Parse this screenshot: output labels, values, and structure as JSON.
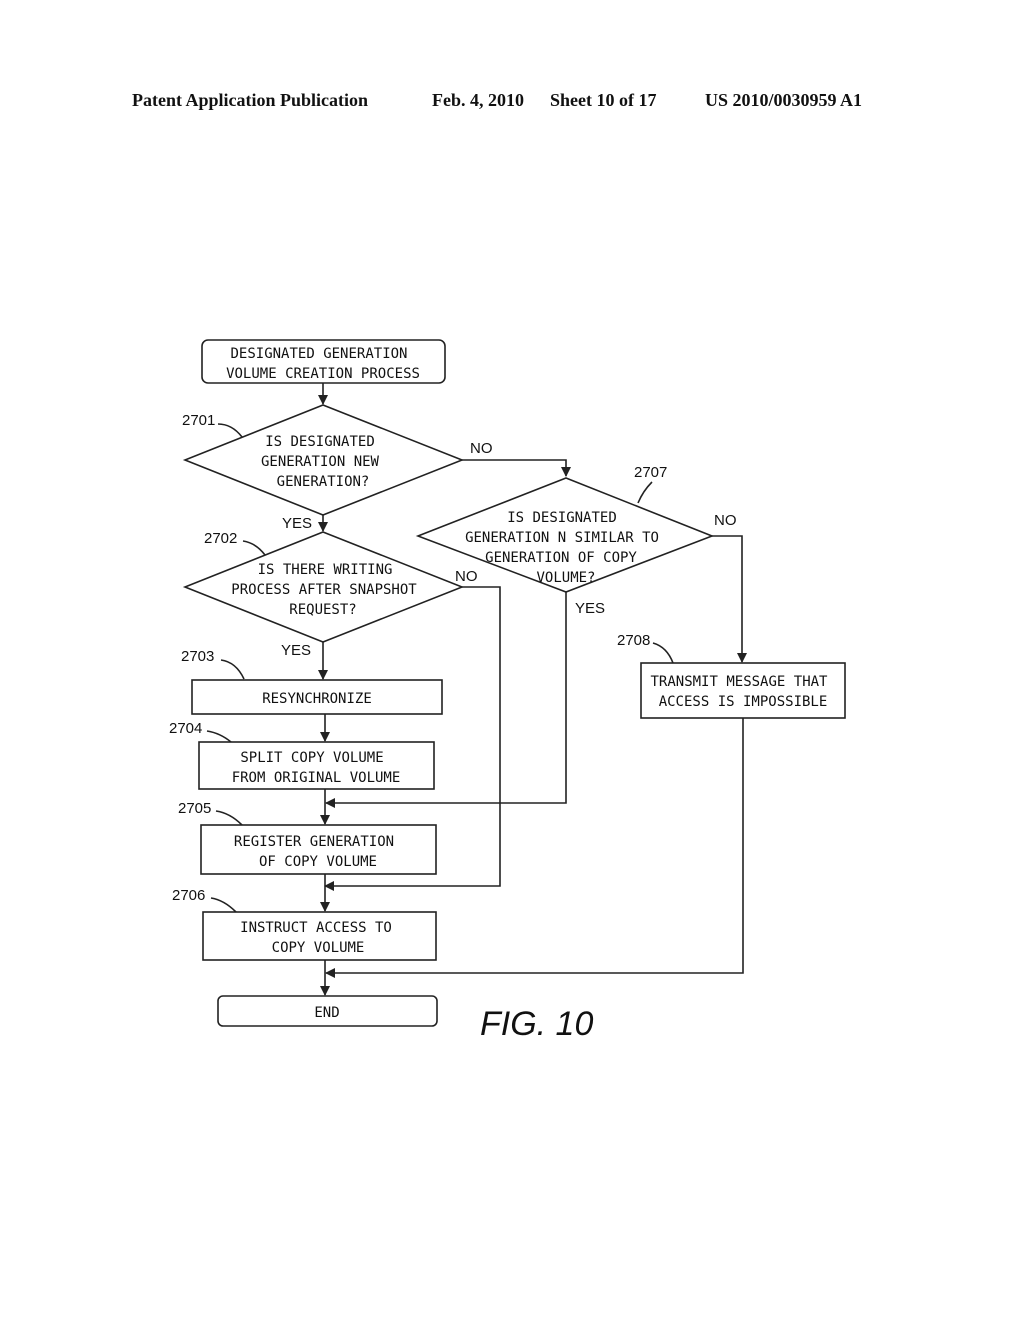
{
  "header": {
    "publication": "Patent Application Publication",
    "date": "Feb. 4, 2010",
    "sheet": "Sheet 10 of 17",
    "number": "US 2010/0030959 A1"
  },
  "figure": {
    "label": "FIG. 10"
  },
  "nodes": {
    "start": {
      "lines": [
        "DESIGNATED GENERATION",
        "VOLUME CREATION PROCESS"
      ]
    },
    "n2701": {
      "ref": "2701",
      "lines": [
        "IS DESIGNATED",
        "GENERATION NEW",
        "GENERATION?"
      ]
    },
    "n2702": {
      "ref": "2702",
      "lines": [
        "IS THERE WRITING",
        "PROCESS AFTER SNAPSHOT",
        "REQUEST?"
      ]
    },
    "n2703": {
      "ref": "2703",
      "lines": [
        "RESYNCHRONIZE"
      ]
    },
    "n2704": {
      "ref": "2704",
      "lines": [
        "SPLIT COPY VOLUME",
        "FROM ORIGINAL VOLUME"
      ]
    },
    "n2705": {
      "ref": "2705",
      "lines": [
        "REGISTER GENERATION",
        "OF COPY VOLUME"
      ]
    },
    "n2706": {
      "ref": "2706",
      "lines": [
        "INSTRUCT ACCESS TO",
        "COPY VOLUME"
      ]
    },
    "n2707": {
      "ref": "2707",
      "lines": [
        "IS DESIGNATED",
        "GENERATION N SIMILAR TO",
        "GENERATION OF COPY",
        "VOLUME?"
      ]
    },
    "n2708": {
      "ref": "2708",
      "lines": [
        "TRANSMIT MESSAGE THAT",
        "ACCESS IS IMPOSSIBLE"
      ]
    },
    "end": {
      "lines": [
        "END"
      ]
    }
  },
  "edges": {
    "yes": "YES",
    "no": "NO"
  }
}
